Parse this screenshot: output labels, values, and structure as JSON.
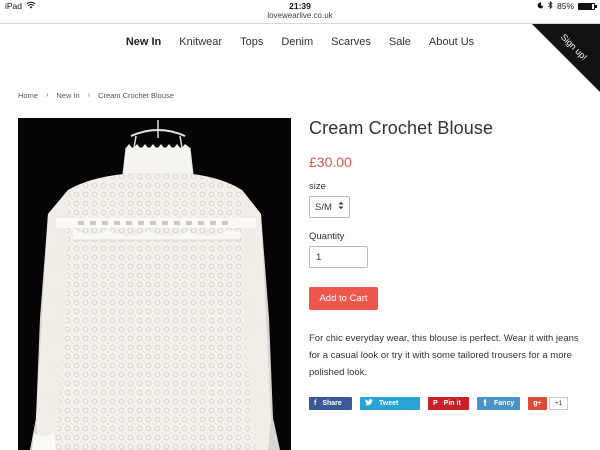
{
  "status_bar": {
    "device": "iPad",
    "time": "21:39",
    "battery": "85%",
    "battery_level": 0.85
  },
  "browser": {
    "url": "lovewearlive.co.uk"
  },
  "nav": {
    "items": [
      "New In",
      "Knitwear",
      "Tops",
      "Denim",
      "Scarves",
      "Sale",
      "About Us"
    ],
    "active": "New In"
  },
  "signup": {
    "label": "Sign up!"
  },
  "breadcrumb": [
    "Home",
    "New In",
    "Cream Crochet Blouse"
  ],
  "product": {
    "title": "Cream Crochet Blouse",
    "price": "£30.00",
    "size_label": "size",
    "size_value": "S/M",
    "quantity_label": "Quantity",
    "quantity_value": "1",
    "add_to_cart": "Add to Cart",
    "description": "For chic everyday wear, this blouse is perfect. Wear it with jeans for a casual look or try it with some tailored trousers for a more polished look."
  },
  "share": {
    "facebook": "Share",
    "twitter": "Tweet",
    "pinterest": "Pin it",
    "fancy": "Fancy",
    "gplus": "g+",
    "gplus_count": "+1"
  },
  "colors": {
    "price": "#e0584d",
    "cart_button": "#f0574c",
    "facebook": "#3b5998",
    "twitter": "#2aa3d6",
    "pinterest": "#cb2027",
    "fancy": "#4b92c9",
    "gplus": "#dd4b39"
  }
}
